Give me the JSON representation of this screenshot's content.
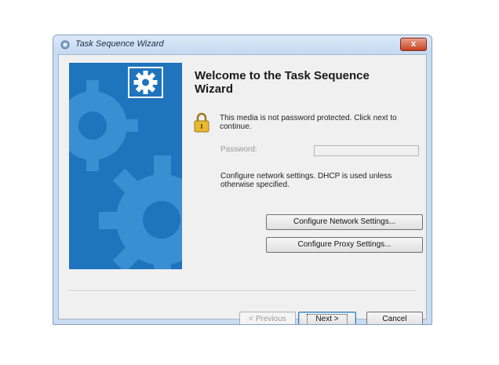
{
  "window": {
    "title": "Task Sequence Wizard",
    "close_label": "x"
  },
  "page": {
    "heading": "Welcome to the Task Sequence Wizard",
    "password_notice": "This media is not password protected.  Click next to continue.",
    "password_label": "Password:",
    "password_value": "",
    "network_text": "Configure network settings. DHCP is used unless otherwise specified."
  },
  "buttons": {
    "network": "Configure Network Settings...",
    "proxy": "Configure Proxy Settings...",
    "previous": "< Previous",
    "next": "Next >",
    "cancel": "Cancel"
  },
  "icons": {
    "app": "wizard-icon",
    "banner": "gear-icon",
    "lock": "lock-icon"
  },
  "colors": {
    "banner": "#1e74bd",
    "gear": "#3a8ed2"
  }
}
